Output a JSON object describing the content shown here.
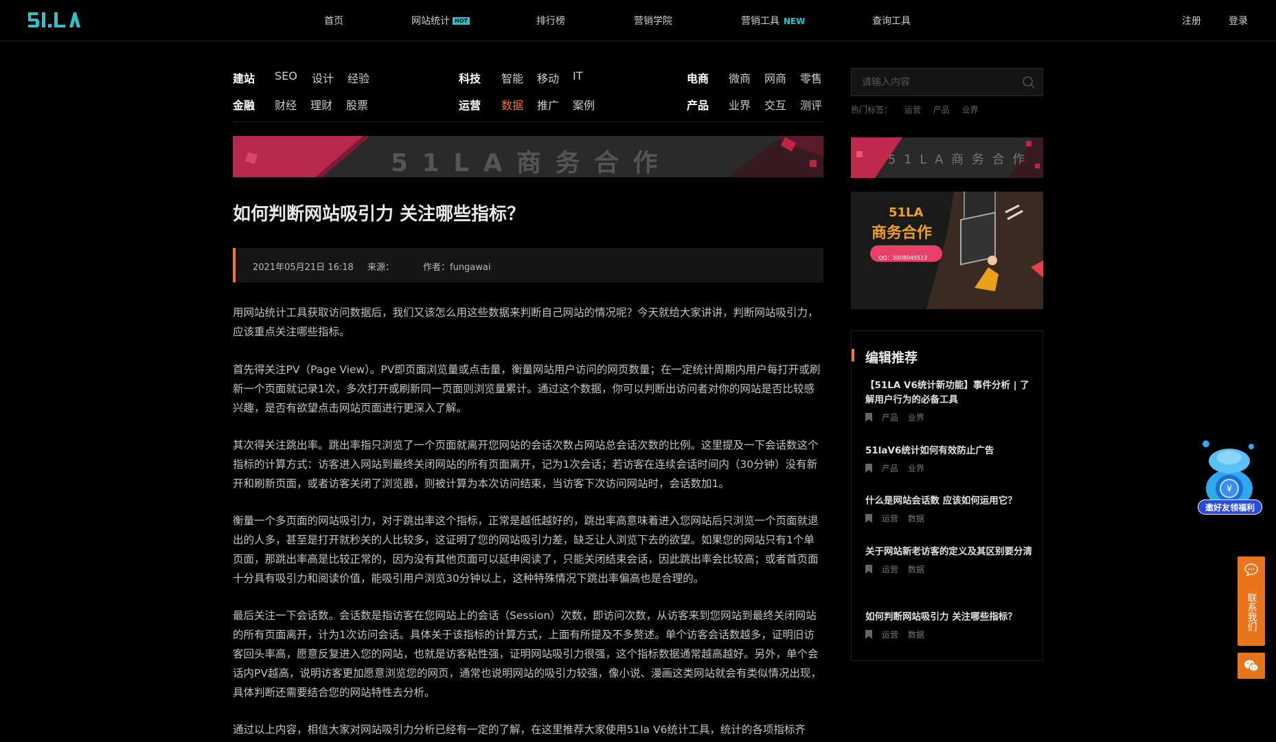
{
  "header": {
    "logo_text": "51.LA",
    "nav": [
      {
        "label": "首页"
      },
      {
        "label": "网站统计",
        "badge": "HOT"
      },
      {
        "label": "排行榜"
      },
      {
        "label": "营销学院"
      },
      {
        "label": "营销工具",
        "badge": "NEW"
      },
      {
        "label": "查询工具"
      }
    ],
    "register": "注册",
    "login": "登录"
  },
  "categories": [
    {
      "head": "建站",
      "items": [
        "SEO",
        "设计",
        "经验"
      ]
    },
    {
      "head": "科技",
      "items": [
        "智能",
        "移动",
        "IT"
      ]
    },
    {
      "head": "电商",
      "items": [
        "微商",
        "网商",
        "零售"
      ]
    },
    {
      "head": "金融",
      "items": [
        "财经",
        "理财",
        "股票"
      ]
    },
    {
      "head": "运营",
      "items": [
        "数据",
        "推广",
        "案例"
      ],
      "active": "数据"
    },
    {
      "head": "产品",
      "items": [
        "业界",
        "交互",
        "测评"
      ]
    }
  ],
  "search": {
    "placeholder": "请输入内容",
    "hot_label": "热门标签：",
    "hot_tags": [
      "运营",
      "产品",
      "业界"
    ]
  },
  "banners": {
    "main_text": "5 1 L A 商 务 合 作",
    "side_text": "5 1 L A 商 务 合 作",
    "ad_title": "51LA",
    "ad_subtitle": "商务合作",
    "ad_qq": "QQ：3008049512"
  },
  "article": {
    "title": "如何判断网站吸引力 关注哪些指标？",
    "date": "2021年05月21日 16:18",
    "source_label": "来源：",
    "author": "作者：fungawai",
    "paragraphs": [
      "用网站统计工具获取访问数据后，我们又该怎么用这些数据来判断自己网站的情况呢？今天就给大家讲讲，判断网站吸引力，应该重点关注哪些指标。",
      "首先得关注PV（Page View）。PV即页面浏览量或点击量，衡量网站用户访问的网页数量；在一定统计周期内用户每打开或刷新一个页面就记录1次，多次打开或刷新同一页面则浏览量累计。通过这个数据，你可以判断出访问者对你的网站是否比较感兴趣，是否有欲望点击网站页面进行更深入了解。",
      "其次得关注跳出率。跳出率指只浏览了一个页面就离开您网站的会话次数占网站总会话次数的比例。这里提及一下会话数这个指标的计算方式：访客进入网站到最终关闭网站的所有页面离开，记为1次会话；若访客在连续会话时间内（30分钟）没有新开和刷新页面，或者访客关闭了浏览器，则被计算为本次访问结束，当访客下次访问网站时，会话数加1。",
      "衡量一个多页面的网站吸引力，对于跳出率这个指标，正常是越低越好的，跳出率高意味着进入您网站后只浏览一个页面就退出的人多，甚至是打开就秒关的人比较多，这证明了您的网站吸引力差，缺乏让人浏览下去的欲望。如果您的网站只有1个单页面，那跳出率高是比较正常的，因为没有其他页面可以延申阅读了，只能关闭结束会话，因此跳出率会比较高；或者首页面十分具有吸引力和阅读价值，能吸引用户浏览30分钟以上，这种特殊情况下跳出率偏高也是合理的。",
      "最后关注一下会话数。会话数是指访客在您网站上的会话（Session）次数，即访问次数，从访客来到您网站到最终关闭网站的所有页面离开，计为1次访问会话。具体关于该指标的计算方式，上面有所提及不多赘述。单个访客会话数越多，证明旧访客回头率高，愿意反复进入您的网站，也就是访客粘性强，证明网站吸引力很强，这个指标数据通常越高越好。另外，单个会话内PV越高，说明访客更加愿意浏览您的网页，通常也说明网站的吸引力较强，像小说、漫画这类网站就会有类似情况出现，具体判断还需要结合您的网站特性去分析。",
      "通过以上内容，相信大家对网站吸引力分析已经有一定的了解，在这里推荐大家使用51la V6统计工具，统计的各项指标齐"
    ]
  },
  "picks": {
    "title": "编辑推荐",
    "items": [
      {
        "title": "【51LA V6统计新功能】事件分析 | 了解用户行为的必备工具",
        "tags": [
          "产品",
          "业界"
        ]
      },
      {
        "title": "51laV6统计如何有效防止广告",
        "tags": [
          "产品",
          "业界"
        ]
      },
      {
        "title": "什么是网站会话数 应该如何运用它？",
        "tags": [
          "运营",
          "数据"
        ]
      },
      {
        "title": "关于网站新老访客的定义及其区别要分清",
        "tags": [
          "运营",
          "数据"
        ]
      },
      {
        "title": "如何判断网站吸引力 关注哪些指标？",
        "tags": [
          "运营",
          "数据"
        ]
      }
    ]
  },
  "floating": {
    "invite": "邀好友领福利",
    "contact": "联系我们"
  },
  "colors": {
    "accent": "#e87a3b",
    "brand": "#27c6cf",
    "contact": "#e8751c"
  }
}
